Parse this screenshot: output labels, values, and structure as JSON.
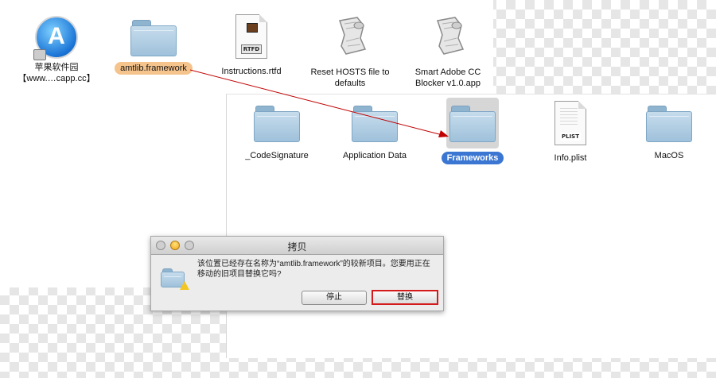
{
  "top_window": {
    "items": [
      {
        "label": "苹果软件园\n【www.…capp.cc】",
        "icon": "app-store-icon"
      },
      {
        "label": "amtlib.framework",
        "icon": "folder-icon",
        "highlight": "#f5c38c"
      },
      {
        "label": "Instructions.rtfd",
        "icon": "rtfd-document-icon",
        "badge": "RTFD"
      },
      {
        "label": "Reset HOSTS file to\ndefaults",
        "icon": "applescript-icon"
      },
      {
        "label": "Smart Adobe CC\nBlocker v1.0.app",
        "icon": "applescript-icon"
      }
    ]
  },
  "front_window": {
    "items": [
      {
        "label": "_CodeSignature",
        "icon": "folder-icon"
      },
      {
        "label": "Application Data",
        "icon": "folder-icon"
      },
      {
        "label": "Frameworks",
        "icon": "folder-icon",
        "highlight": "#3a76d2"
      },
      {
        "label": "Info.plist",
        "icon": "plist-document-icon",
        "badge": "PLIST"
      },
      {
        "label": "MacOS",
        "icon": "folder-icon"
      }
    ]
  },
  "dialog": {
    "title": "拷贝",
    "message": "该位置已经存在名称为“amtlib.framework”的较新项目。您要用正在移动的旧项目替换它吗?",
    "stop_label": "停止",
    "replace_label": "替换",
    "highlight_color": "#d41a1a"
  },
  "annotation": {
    "arrow_color": "#c00000"
  }
}
